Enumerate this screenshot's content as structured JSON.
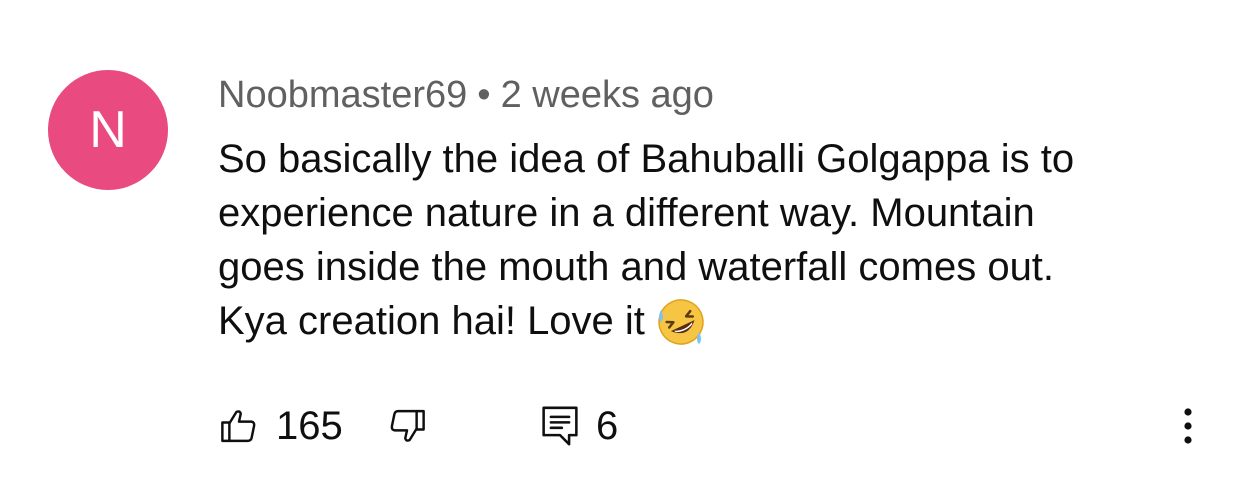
{
  "comment": {
    "avatar_letter": "N",
    "avatar_color": "#e94a7f",
    "author": "Noobmaster69",
    "separator": "•",
    "timestamp": "2 weeks ago",
    "text_lines": [
      "So basically the idea of Bahuballi Golgappa is to",
      "experience nature in a different way. Mountain",
      "goes inside the mouth and waterfall comes out.",
      "Kya creation hai! Love it"
    ],
    "emoji": "rolling-on-the-floor-laughing-emoji"
  },
  "actions": {
    "like_icon": "thumbs-up-icon",
    "like_count": "165",
    "dislike_icon": "thumbs-down-icon",
    "reply_icon": "reply-comment-icon",
    "reply_count": "6",
    "more_icon": "more-vertical-icon"
  }
}
